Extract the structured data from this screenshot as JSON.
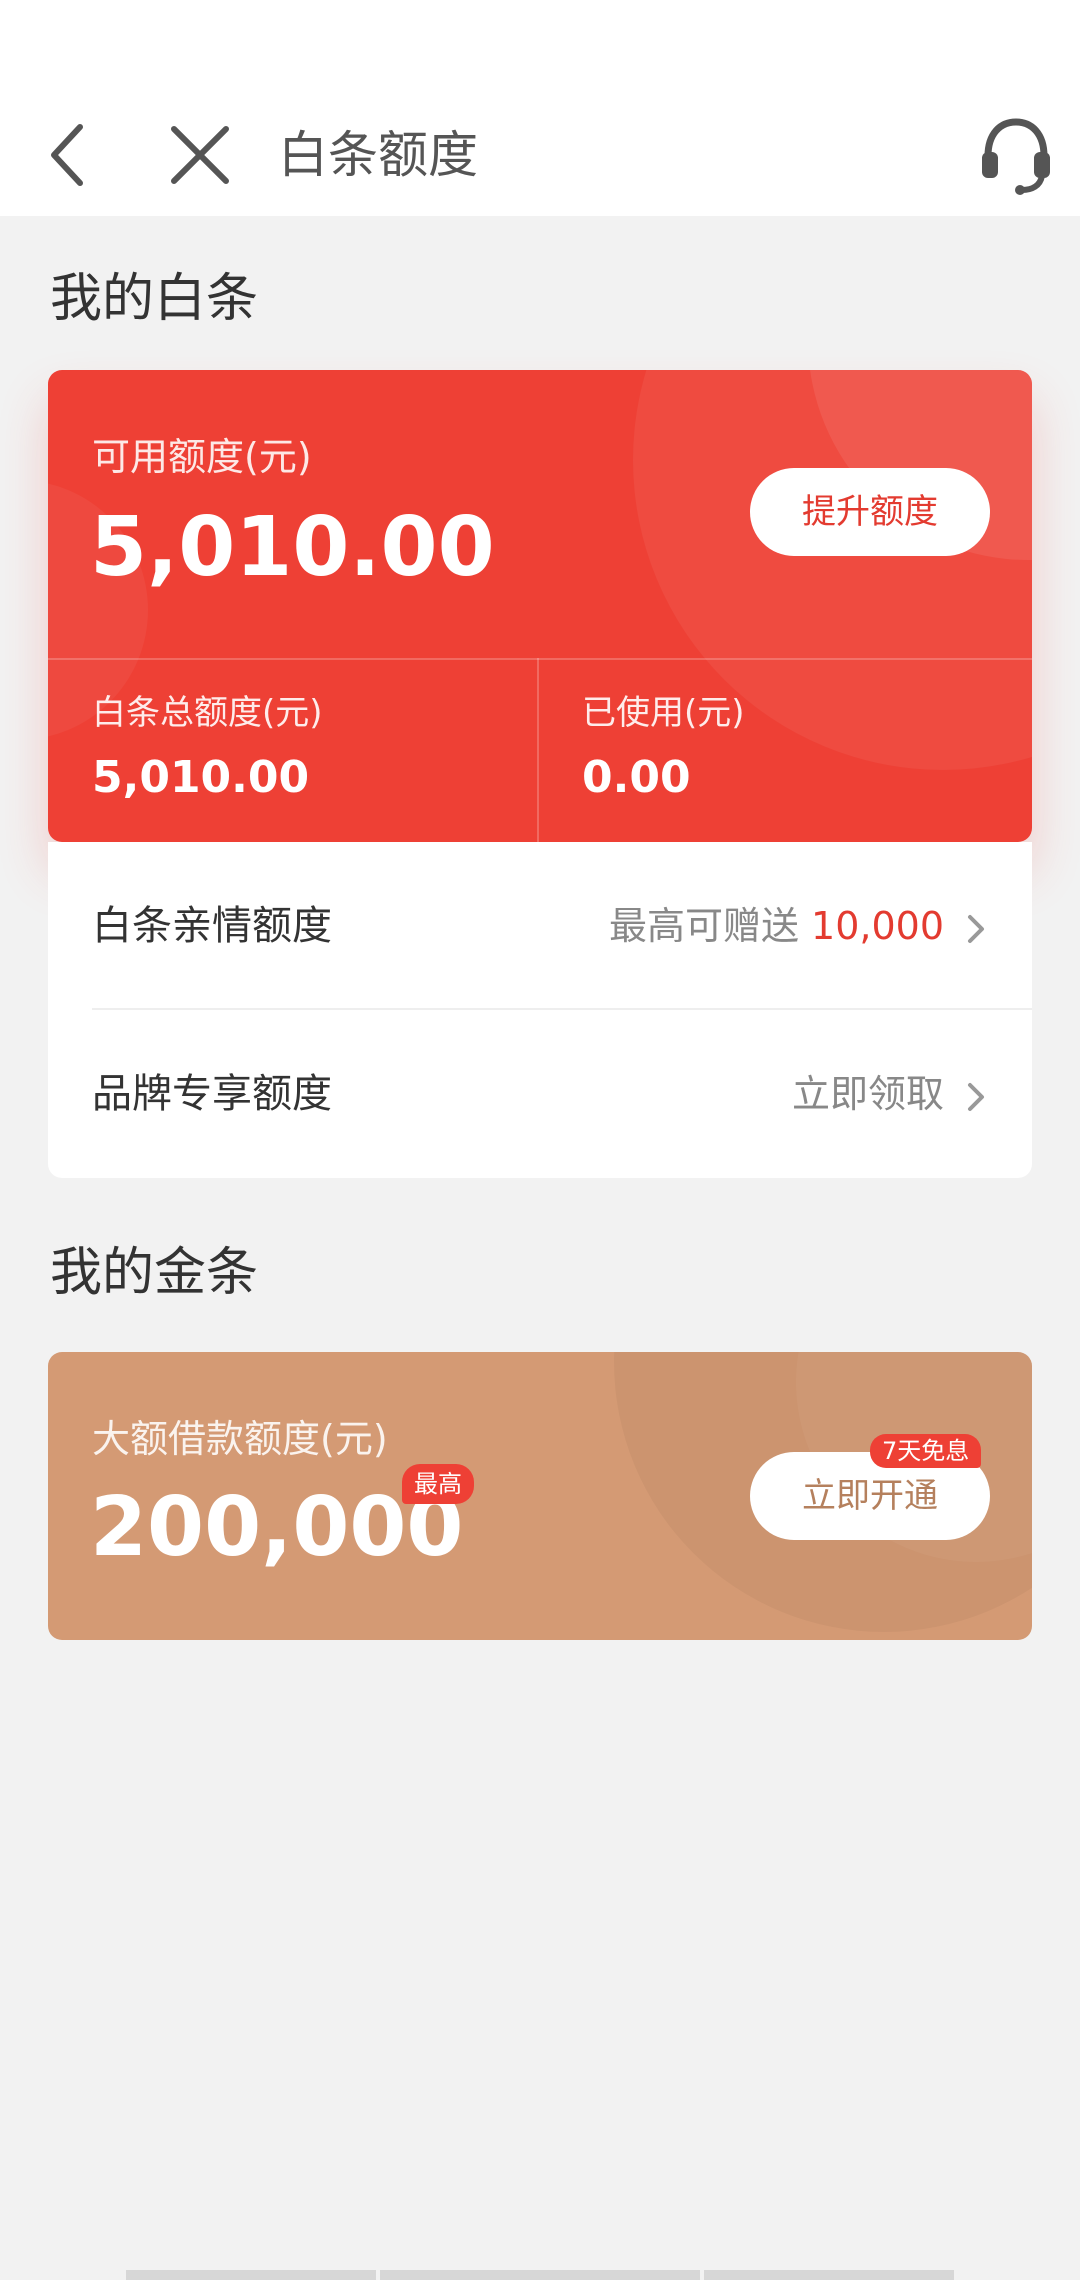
{
  "nav": {
    "title": "白条额度",
    "back_icon": "back-arrow-icon",
    "close_icon": "close-icon",
    "support_icon": "customer-service-headset-icon"
  },
  "baitiao": {
    "section_title": "我的白条",
    "available_label": "可用额度(元)",
    "available_value": "5,010.00",
    "raise_button": "提升额度",
    "total_label": "白条总额度(元)",
    "total_value": "5,010.00",
    "used_label": "已使用(元)",
    "used_value": "0.00",
    "card_color": "#ee4035"
  },
  "limits": {
    "family": {
      "label": "白条亲情额度",
      "prefix": "最高可赠送",
      "amount": "10,000"
    },
    "brand": {
      "label": "品牌专享额度",
      "action": "立即领取"
    }
  },
  "jintiao": {
    "section_title": "我的金条",
    "loan_label": "大额借款额度(元)",
    "loan_value": "200,000",
    "max_badge": "最高",
    "open_button": "立即开通",
    "free_badge": "7天免息",
    "card_color": "#d49a74"
  }
}
